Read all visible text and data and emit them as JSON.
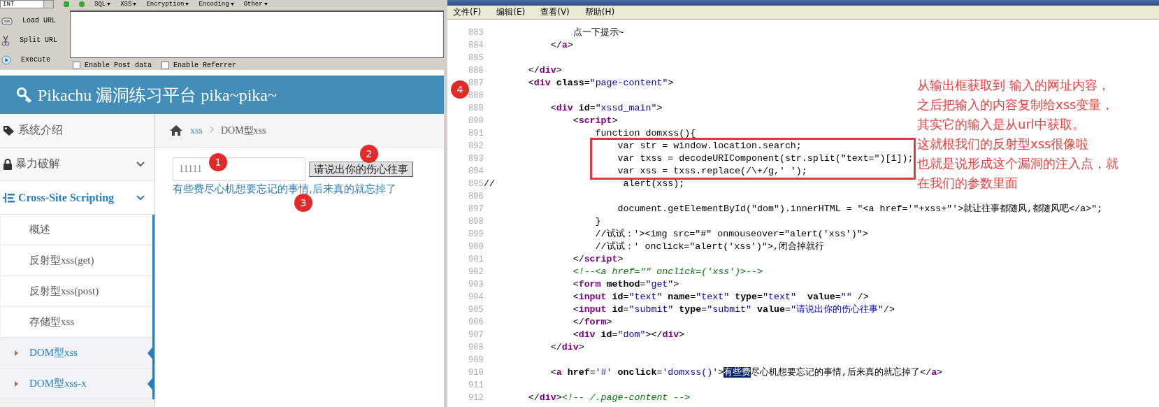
{
  "hackbar": {
    "dropdown": "INT",
    "menus": [
      "SQL",
      "XSS",
      "Encryption",
      "Encoding",
      "Other"
    ],
    "buttons": [
      "Load URL",
      "Split URL",
      "Execute"
    ],
    "options": [
      {
        "label": "Enable Post data",
        "checked": false
      },
      {
        "label": "Enable Referrer",
        "checked": false
      }
    ]
  },
  "site": {
    "title": "Pikachu 漏洞练习平台 pika~pika~"
  },
  "sidebar": [
    {
      "label": "系统介绍",
      "kind": "plain",
      "active": false
    },
    {
      "label": "暴力破解",
      "kind": "group",
      "active": false
    },
    {
      "label": "Cross-Site Scripting",
      "kind": "group",
      "active": true,
      "children": [
        {
          "label": "概述",
          "selected": false
        },
        {
          "label": "反射型xss(get)",
          "selected": false
        },
        {
          "label": "反射型xss(post)",
          "selected": false
        },
        {
          "label": "存储型xss",
          "selected": false
        },
        {
          "label": "DOM型xss",
          "selected": true
        },
        {
          "label": "DOM型xss-x",
          "selected": true
        }
      ]
    }
  ],
  "breadcrumb": [
    "xss",
    "DOM型xss"
  ],
  "form": {
    "value": "11111",
    "button": "请说出你的伤心往事",
    "link": "有些费尽心机想要忘记的事情,后来真的就忘掉了"
  },
  "markers": [
    "1",
    "2",
    "3",
    "4"
  ],
  "editor": {
    "menu": [
      "文件(F)",
      "编辑(E)",
      "查看(V)",
      "帮助(H)"
    ],
    "lines": [
      {
        "num": "883",
        "segs": [
          {
            "kind": "p",
            "text": "                点一下提示~"
          }
        ]
      },
      {
        "num": "884",
        "segs": [
          {
            "kind": "p",
            "text": "            </"
          },
          {
            "kind": "tag",
            "text": "a"
          },
          {
            "kind": "p",
            "text": ">"
          }
        ]
      },
      {
        "num": "885"
      },
      {
        "num": "886",
        "segs": [
          {
            "kind": "p",
            "text": "        </"
          },
          {
            "kind": "tag",
            "text": "div"
          },
          {
            "kind": "p",
            "text": ">"
          }
        ]
      },
      {
        "num": "887",
        "segs": [
          {
            "kind": "p",
            "text": "        <"
          },
          {
            "kind": "tag",
            "text": "div"
          },
          {
            "kind": "attr",
            "text": " class"
          },
          {
            "kind": "p",
            "text": "="
          },
          {
            "kind": "val",
            "text": "\"page-content\""
          },
          {
            "kind": "p",
            "text": ">"
          }
        ]
      },
      {
        "num": "888"
      },
      {
        "num": "889",
        "segs": [
          {
            "kind": "p",
            "text": "            <"
          },
          {
            "kind": "tag",
            "text": "div"
          },
          {
            "kind": "attr",
            "text": " id"
          },
          {
            "kind": "p",
            "text": "="
          },
          {
            "kind": "val",
            "text": "\"xssd_main\""
          },
          {
            "kind": "p",
            "text": ">"
          }
        ]
      },
      {
        "num": "890",
        "segs": [
          {
            "kind": "p",
            "text": "                <"
          },
          {
            "kind": "tag",
            "text": "script"
          },
          {
            "kind": "p",
            "text": ">"
          }
        ]
      },
      {
        "num": "891",
        "segs": [
          {
            "kind": "p",
            "text": "                    function domxss(){"
          }
        ]
      },
      {
        "num": "892",
        "segs": [
          {
            "kind": "p",
            "text": "                        var str = window.location.search;"
          }
        ]
      },
      {
        "num": "893",
        "segs": [
          {
            "kind": "p",
            "text": "                        var txss = decodeURIComponent(str.split(\"text=\")[1]);"
          }
        ]
      },
      {
        "num": "894",
        "segs": [
          {
            "kind": "p",
            "text": "                        var xss = txss.replace(/\\+/g,' ');"
          }
        ]
      },
      {
        "num": "895",
        "segs": [
          {
            "kind": "p",
            "text": "//                       alert(xss);"
          }
        ]
      },
      {
        "num": "896"
      },
      {
        "num": "897",
        "segs": [
          {
            "kind": "p",
            "text": "                        document.getElementById(\"dom\").innerHTML = \"<a href='\"+xss+\"'>就让往事都随风,都随风吧</a>\";"
          }
        ]
      },
      {
        "num": "898",
        "segs": [
          {
            "kind": "p",
            "text": "                    }"
          }
        ]
      },
      {
        "num": "899",
        "segs": [
          {
            "kind": "p",
            "text": "                    //试试：'><img src=\"#\" onmouseover=\"alert('xss')\">"
          }
        ]
      },
      {
        "num": "900",
        "segs": [
          {
            "kind": "p",
            "text": "                    //试试：' onclick=\"alert('xss')\">,闭合掉就行"
          }
        ]
      },
      {
        "num": "901",
        "segs": [
          {
            "kind": "p",
            "text": "                </"
          },
          {
            "kind": "tag",
            "text": "script"
          },
          {
            "kind": "p",
            "text": ">"
          }
        ]
      },
      {
        "num": "902",
        "segs": [
          {
            "kind": "com",
            "text": "                <!--<a href=\"\" onclick=('xss')>-->"
          }
        ]
      },
      {
        "num": "903",
        "segs": [
          {
            "kind": "p",
            "text": "                <"
          },
          {
            "kind": "tag",
            "text": "form"
          },
          {
            "kind": "attr",
            "text": " method"
          },
          {
            "kind": "p",
            "text": "="
          },
          {
            "kind": "val",
            "text": "\"get\""
          },
          {
            "kind": "p",
            "text": ">"
          }
        ]
      },
      {
        "num": "904",
        "segs": [
          {
            "kind": "p",
            "text": "                <"
          },
          {
            "kind": "tag",
            "text": "input"
          },
          {
            "kind": "attr",
            "text": " id"
          },
          {
            "kind": "p",
            "text": "="
          },
          {
            "kind": "val",
            "text": "\"text\""
          },
          {
            "kind": "attr",
            "text": " name"
          },
          {
            "kind": "p",
            "text": "="
          },
          {
            "kind": "val",
            "text": "\"text\""
          },
          {
            "kind": "attr",
            "text": " type"
          },
          {
            "kind": "p",
            "text": "="
          },
          {
            "kind": "val",
            "text": "\"text\""
          },
          {
            "kind": "attr",
            "text": "  value"
          },
          {
            "kind": "p",
            "text": "="
          },
          {
            "kind": "val",
            "text": "\"\""
          },
          {
            "kind": "p",
            "text": " />"
          }
        ]
      },
      {
        "num": "905",
        "segs": [
          {
            "kind": "p",
            "text": "                <"
          },
          {
            "kind": "tag",
            "text": "input"
          },
          {
            "kind": "attr",
            "text": " id"
          },
          {
            "kind": "p",
            "text": "="
          },
          {
            "kind": "val",
            "text": "\"submit\""
          },
          {
            "kind": "attr",
            "text": " type"
          },
          {
            "kind": "p",
            "text": "="
          },
          {
            "kind": "val",
            "text": "\"submit\""
          },
          {
            "kind": "attr",
            "text": " value"
          },
          {
            "kind": "p",
            "text": "="
          },
          {
            "kind": "val",
            "text": "\"请说出你的伤心往事\""
          },
          {
            "kind": "p",
            "text": "/>"
          }
        ]
      },
      {
        "num": "906",
        "segs": [
          {
            "kind": "p",
            "text": "                </"
          },
          {
            "kind": "tag",
            "text": "form"
          },
          {
            "kind": "p",
            "text": ">"
          }
        ]
      },
      {
        "num": "907",
        "segs": [
          {
            "kind": "p",
            "text": "                <"
          },
          {
            "kind": "tag",
            "text": "div"
          },
          {
            "kind": "attr",
            "text": " id"
          },
          {
            "kind": "p",
            "text": "="
          },
          {
            "kind": "val",
            "text": "\"dom\""
          },
          {
            "kind": "p",
            "text": "></"
          },
          {
            "kind": "tag",
            "text": "div"
          },
          {
            "kind": "p",
            "text": ">"
          }
        ]
      },
      {
        "num": "908",
        "segs": [
          {
            "kind": "p",
            "text": "            </"
          },
          {
            "kind": "tag",
            "text": "div"
          },
          {
            "kind": "p",
            "text": ">"
          }
        ]
      },
      {
        "num": "909"
      },
      {
        "num": "910",
        "segs": [
          {
            "kind": "p",
            "text": "            <"
          },
          {
            "kind": "tag",
            "text": "a"
          },
          {
            "kind": "attr",
            "text": " href"
          },
          {
            "kind": "p",
            "text": "="
          },
          {
            "kind": "val",
            "text": "'#'"
          },
          {
            "kind": "attr",
            "text": " onclick"
          },
          {
            "kind": "p",
            "text": "="
          },
          {
            "kind": "val",
            "text": "'domxss()'"
          },
          {
            "kind": "p",
            "text": ">"
          },
          {
            "kind": "sel",
            "text": "有些费"
          },
          {
            "kind": "p",
            "text": "尽心机想要忘记的事情,后来真的就忘掉了</"
          },
          {
            "kind": "tag",
            "text": "a"
          },
          {
            "kind": "p",
            "text": ">"
          }
        ]
      },
      {
        "num": "911"
      },
      {
        "num": "912",
        "segs": [
          {
            "kind": "p",
            "text": "        </"
          },
          {
            "kind": "tag",
            "text": "div"
          },
          {
            "kind": "p",
            "text": ">"
          },
          {
            "kind": "com",
            "text": "<!-- /.page-content -->"
          }
        ]
      }
    ],
    "annotation": [
      "从输出框获取到 输入的网址内容，",
      "之后把输入的内容复制给xss变量，",
      "其实它的输入是从url中获取。",
      "这就根我们的反射型xss很像啦",
      "也就是说形成这个漏洞的注入点，就",
      "在我们的参数里面"
    ]
  }
}
